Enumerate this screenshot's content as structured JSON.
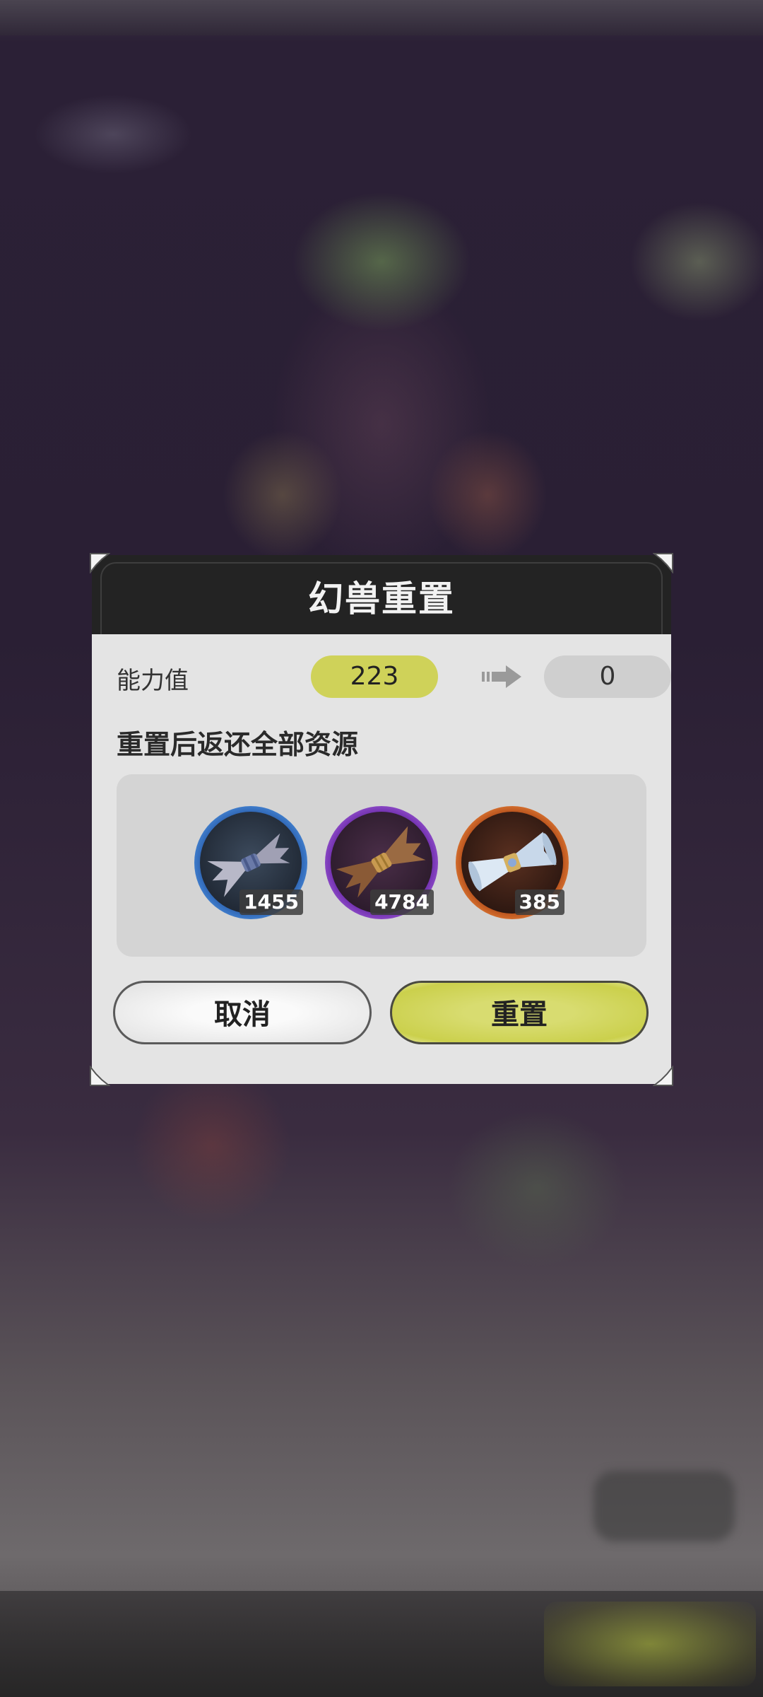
{
  "dialog": {
    "title": "幻兽重置",
    "power_label": "能力值",
    "power_from": "223",
    "power_to": "0",
    "resources_title": "重置后返还全部资源",
    "resources": [
      {
        "icon": "gray-feather-bundle-icon",
        "count": "1455",
        "ring_color": "#4a8fe0"
      },
      {
        "icon": "brown-fur-bundle-icon",
        "count": "4784",
        "ring_color": "#9a4fd6"
      },
      {
        "icon": "white-cloth-bundle-icon",
        "count": "385",
        "ring_color": "#f08030"
      }
    ],
    "cancel_label": "取消",
    "reset_label": "重置"
  },
  "colors": {
    "accent_yellow": "#cfd259",
    "header_dark": "#232323",
    "body_light": "#e4e4e4"
  }
}
